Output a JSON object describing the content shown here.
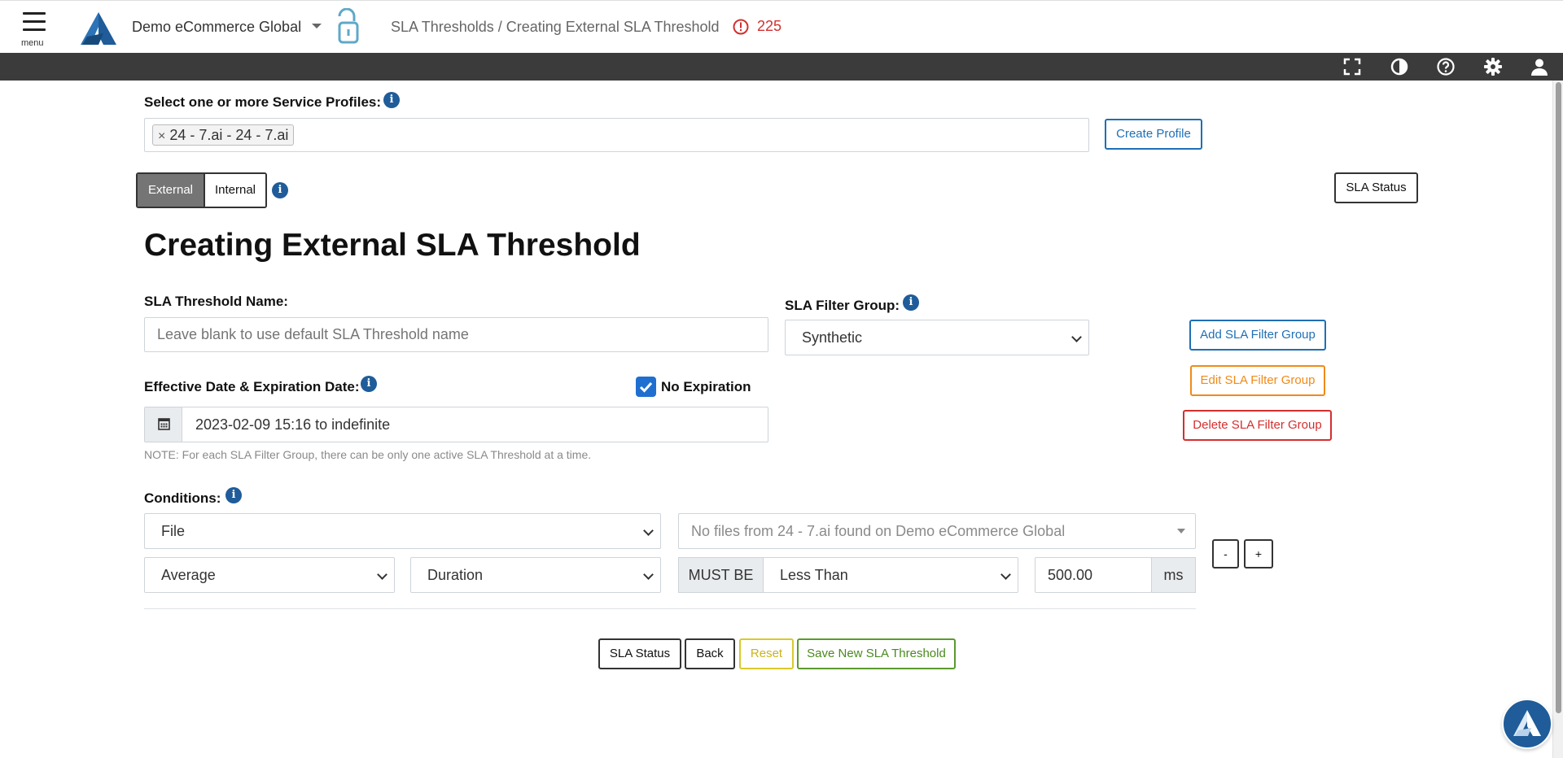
{
  "header": {
    "menu_label": "menu",
    "org_name": "Demo eCommerce Global",
    "breadcrumb": "SLA Thresholds / Creating External SLA Threshold",
    "alert_count": "225",
    "brand_color": "#1f5c99"
  },
  "toolbar": {
    "icons": [
      "fullscreen-icon",
      "contrast-icon",
      "help-icon",
      "gear-icon",
      "user-icon"
    ]
  },
  "profiles": {
    "label": "Select one or more Service Profiles:",
    "selected": [
      {
        "remove": "×",
        "text": "24 - 7.ai - 24 - 7.ai"
      }
    ],
    "create_button": "Create Profile"
  },
  "mode_toggle": {
    "external": "External",
    "internal": "Internal",
    "active": "External"
  },
  "sla_status_top": "SLA Status",
  "page_title": "Creating External SLA Threshold",
  "threshold_name": {
    "label": "SLA Threshold Name:",
    "placeholder": "Leave blank to use default SLA Threshold name",
    "value": ""
  },
  "filter_group": {
    "label": "SLA Filter Group:",
    "value": "Synthetic",
    "add_button": "Add SLA Filter Group",
    "edit_button": "Edit SLA Filter Group",
    "delete_button": "Delete SLA Filter Group"
  },
  "dates": {
    "label": "Effective Date & Expiration Date:",
    "no_expiration_label": "No Expiration",
    "no_expiration_checked": true,
    "value": "2023-02-09 15:16 to indefinite",
    "note": "NOTE: For each SLA Filter Group, there can be only one active SLA Threshold at a time."
  },
  "conditions": {
    "label": "Conditions:",
    "scope": "File",
    "files_placeholder": "No files from 24 - 7.ai found on Demo eCommerce Global",
    "aggregate": "Average",
    "metric": "Duration",
    "must_be": "MUST BE",
    "comparator": "Less Than",
    "threshold_value": "500.00",
    "unit": "ms",
    "remove_button": "-",
    "add_button": "+"
  },
  "footer_buttons": {
    "sla_status": "SLA Status",
    "back": "Back",
    "reset": "Reset",
    "save": "Save New SLA Threshold"
  }
}
